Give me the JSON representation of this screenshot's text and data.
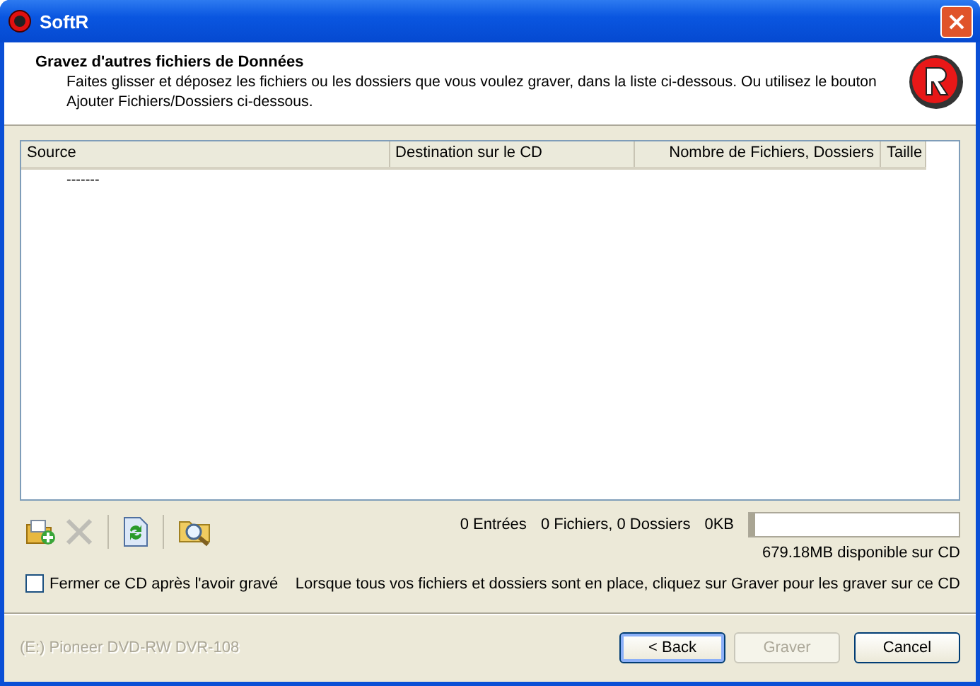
{
  "window": {
    "title": "SoftR"
  },
  "header": {
    "title": "Gravez d'autres fichiers de Données",
    "description": "Faites glisser et déposez les fichiers ou les dossiers que vous voulez graver, dans la liste ci-dessous. Ou utilisez le bouton Ajouter Fichiers/Dossiers ci-dessous."
  },
  "table": {
    "columns": [
      "Source",
      "Destination sur le CD",
      "Nombre de Fichiers, Dossiers",
      "Taille"
    ],
    "rows": [
      [
        "-------"
      ]
    ]
  },
  "toolbar": [
    {
      "kind": "add",
      "disabled": false
    },
    {
      "kind": "delete",
      "disabled": true
    },
    {
      "kind": "refresh",
      "disabled": false
    },
    {
      "kind": "browse",
      "disabled": false
    }
  ],
  "summary": {
    "entries": "0 Entrées",
    "counts": "0 Fichiers, 0 Dossiers",
    "size": "0KB",
    "level": 0.03,
    "available": "679.18MB disponible sur CD"
  },
  "close_cd": {
    "label": "Fermer ce CD après l'avoir gravé",
    "checked": false
  },
  "hint": "Lorsque tous vos fichiers et dossiers sont en place, cliquez sur Graver pour les graver sur ce CD",
  "drive": {
    "label": "(E:) Pioneer DVD-RW DVR-108",
    "disabled": true
  },
  "buttons": [
    {
      "label": "< Back",
      "disabled": false,
      "default": true
    },
    {
      "label": "Graver",
      "disabled": true,
      "default": false
    },
    {
      "label": "Cancel",
      "disabled": false,
      "default": false
    }
  ]
}
